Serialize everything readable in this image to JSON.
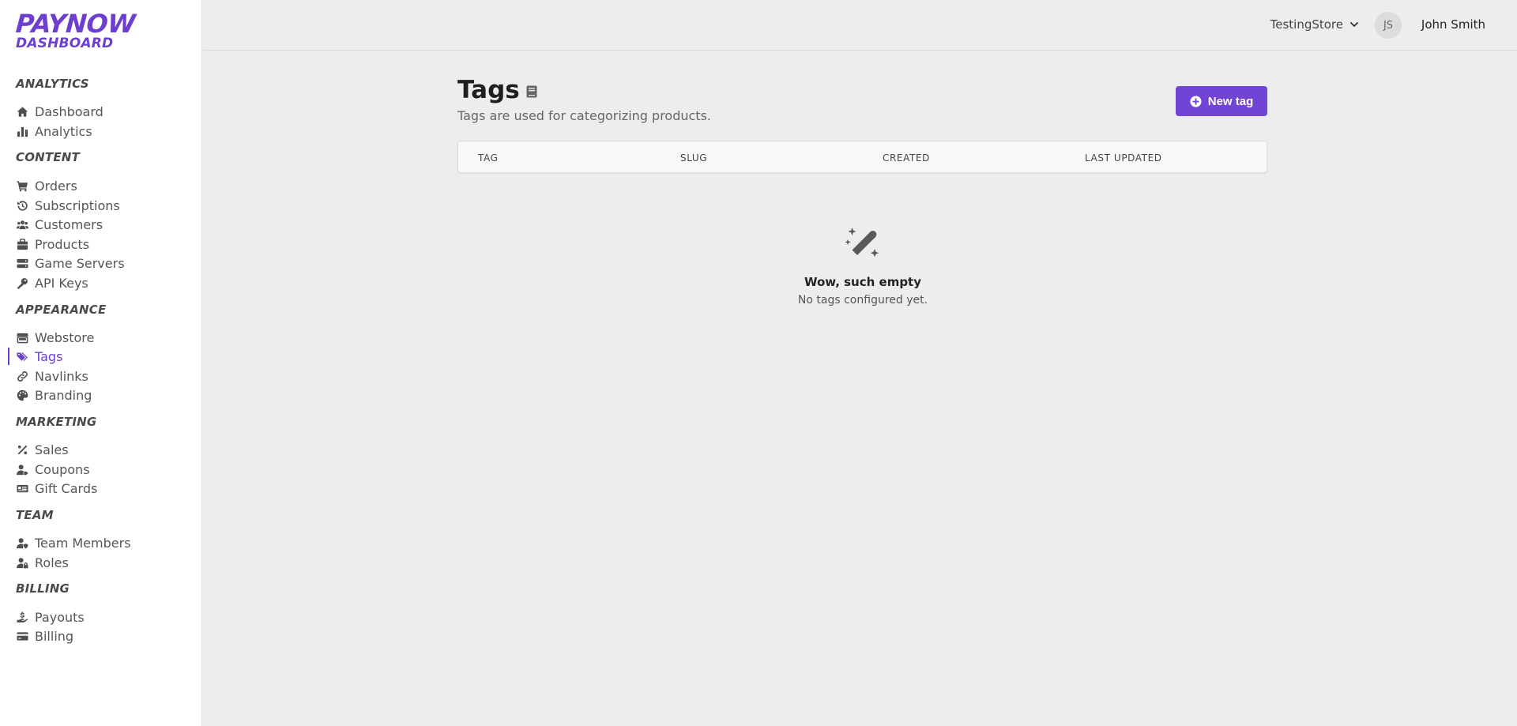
{
  "brand": {
    "line1": "PAYNOW",
    "line2": "DASHBOARD",
    "accent": "#6d3fd0"
  },
  "sections": {
    "analytics": "ANALYTICS",
    "content": "CONTENT",
    "appearance": "APPEARANCE",
    "marketing": "MARKETING",
    "team": "TEAM",
    "billing": "BILLING"
  },
  "nav": {
    "dashboard": "Dashboard",
    "analytics": "Analytics",
    "orders": "Orders",
    "subscriptions": "Subscriptions",
    "customers": "Customers",
    "products": "Products",
    "game_servers": "Game Servers",
    "api_keys": "API Keys",
    "webstore": "Webstore",
    "tags": "Tags",
    "navlinks": "Navlinks",
    "branding": "Branding",
    "sales": "Sales",
    "coupons": "Coupons",
    "gift_cards": "Gift Cards",
    "team_members": "Team Members",
    "roles": "Roles",
    "payouts": "Payouts",
    "billing": "Billing"
  },
  "topbar": {
    "store": "TestingStore",
    "avatar_initials": "JS",
    "user_name": "John Smith"
  },
  "page": {
    "title": "Tags",
    "subtitle": "Tags are used for categorizing products.",
    "new_button": "New tag"
  },
  "table": {
    "columns": [
      "TAG",
      "SLUG",
      "CREATED",
      "LAST UPDATED"
    ]
  },
  "empty_state": {
    "icon": "magic-wand-icon",
    "title": "Wow, such empty",
    "subtitle": "No tags configured yet."
  }
}
